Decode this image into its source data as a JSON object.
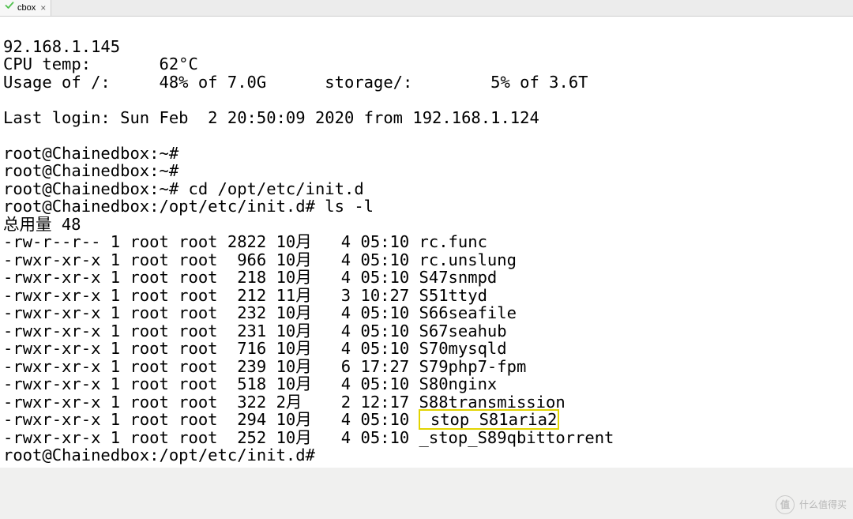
{
  "tabbar": {
    "tabs": [
      {
        "label": "cbox",
        "closeable": true,
        "icon": "check"
      }
    ]
  },
  "motd": {
    "ip": "92.168.1.145",
    "cpu": {
      "label": "CPU temp:",
      "value": "62°C"
    },
    "root_usage": {
      "label": "Usage of /:",
      "value": "48% of 7.0G"
    },
    "storage_usage": {
      "label": "storage/:",
      "value": "5% of 3.6T"
    },
    "last_login": "Last login: Sun Feb  2 20:50:09 2020 from 192.168.1.124"
  },
  "session": {
    "prompts": {
      "home": "root@Chainedbox:~#",
      "initd": "root@Chainedbox:/opt/etc/init.d#"
    },
    "blank": "",
    "cmd_cd": "cd /opt/etc/init.d",
    "cmd_ls": "ls -l"
  },
  "listing": {
    "header": "总用量 48",
    "rows": [
      {
        "perm": "-rw-r--r--",
        "n": "1",
        "own": "root",
        "grp": "root",
        "size": "2822",
        "mon": "10月",
        "day": "4",
        "time": "05:10",
        "name": "rc.func",
        "hl": false
      },
      {
        "perm": "-rwxr-xr-x",
        "n": "1",
        "own": "root",
        "grp": "root",
        "size": "966",
        "mon": "10月",
        "day": "4",
        "time": "05:10",
        "name": "rc.unslung",
        "hl": false
      },
      {
        "perm": "-rwxr-xr-x",
        "n": "1",
        "own": "root",
        "grp": "root",
        "size": "218",
        "mon": "10月",
        "day": "4",
        "time": "05:10",
        "name": "S47snmpd",
        "hl": false
      },
      {
        "perm": "-rwxr-xr-x",
        "n": "1",
        "own": "root",
        "grp": "root",
        "size": "212",
        "mon": "11月",
        "day": "3",
        "time": "10:27",
        "name": "S51ttyd",
        "hl": false
      },
      {
        "perm": "-rwxr-xr-x",
        "n": "1",
        "own": "root",
        "grp": "root",
        "size": "232",
        "mon": "10月",
        "day": "4",
        "time": "05:10",
        "name": "S66seafile",
        "hl": false
      },
      {
        "perm": "-rwxr-xr-x",
        "n": "1",
        "own": "root",
        "grp": "root",
        "size": "231",
        "mon": "10月",
        "day": "4",
        "time": "05:10",
        "name": "S67seahub",
        "hl": false
      },
      {
        "perm": "-rwxr-xr-x",
        "n": "1",
        "own": "root",
        "grp": "root",
        "size": "716",
        "mon": "10月",
        "day": "4",
        "time": "05:10",
        "name": "S70mysqld",
        "hl": false
      },
      {
        "perm": "-rwxr-xr-x",
        "n": "1",
        "own": "root",
        "grp": "root",
        "size": "239",
        "mon": "10月",
        "day": "6",
        "time": "17:27",
        "name": "S79php7-fpm",
        "hl": false
      },
      {
        "perm": "-rwxr-xr-x",
        "n": "1",
        "own": "root",
        "grp": "root",
        "size": "518",
        "mon": "10月",
        "day": "4",
        "time": "05:10",
        "name": "S80nginx",
        "hl": false
      },
      {
        "perm": "-rwxr-xr-x",
        "n": "1",
        "own": "root",
        "grp": "root",
        "size": "322",
        "mon": "2月",
        "day": "2",
        "time": "12:17",
        "name": "S88transmission",
        "hl": false
      },
      {
        "perm": "-rwxr-xr-x",
        "n": "1",
        "own": "root",
        "grp": "root",
        "size": "294",
        "mon": "10月",
        "day": "4",
        "time": "05:10",
        "name": "_stop_S81aria2",
        "hl": true
      },
      {
        "perm": "-rwxr-xr-x",
        "n": "1",
        "own": "root",
        "grp": "root",
        "size": "252",
        "mon": "10月",
        "day": "4",
        "time": "05:10",
        "name": "_stop_S89qbittorrent",
        "hl": false
      }
    ]
  },
  "watermark": {
    "text": "什么值得买",
    "icon": "值"
  }
}
